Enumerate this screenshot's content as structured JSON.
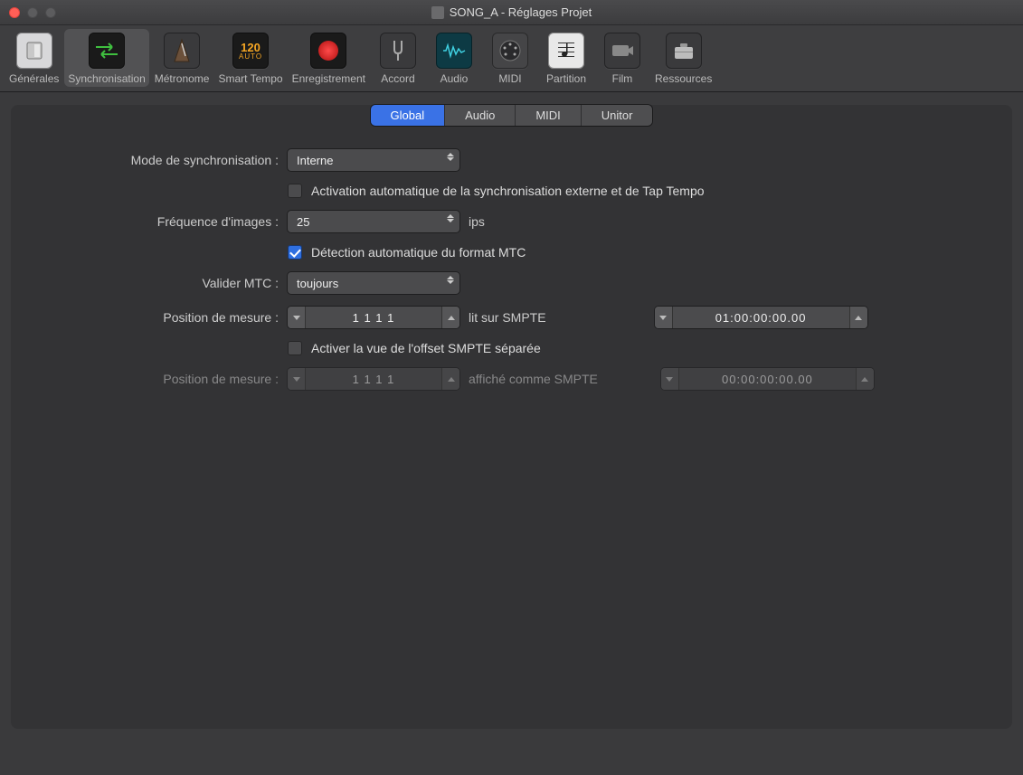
{
  "window": {
    "title": "SONG_A - Réglages Projet"
  },
  "toolbar": {
    "items": [
      {
        "label": "Générales",
        "icon": "switch-icon"
      },
      {
        "label": "Synchronisation",
        "icon": "sync-arrows-icon",
        "active": true
      },
      {
        "label": "Métronome",
        "icon": "metronome-icon"
      },
      {
        "label": "Smart Tempo",
        "icon": "smart-tempo-icon"
      },
      {
        "label": "Enregistrement",
        "icon": "record-icon"
      },
      {
        "label": "Accord",
        "icon": "tuning-fork-icon"
      },
      {
        "label": "Audio",
        "icon": "audio-wave-icon"
      },
      {
        "label": "MIDI",
        "icon": "midi-icon"
      },
      {
        "label": "Partition",
        "icon": "score-icon"
      },
      {
        "label": "Film",
        "icon": "film-icon"
      },
      {
        "label": "Ressources",
        "icon": "briefcase-icon"
      }
    ]
  },
  "tabs": {
    "items": [
      "Global",
      "Audio",
      "MIDI",
      "Unitor"
    ],
    "selected": 0
  },
  "form": {
    "sync_mode_label": "Mode de synchronisation :",
    "sync_mode_value": "Interne",
    "auto_ext_sync_label": "Activation automatique de la synchronisation externe et de Tap Tempo",
    "auto_ext_sync_checked": false,
    "frame_rate_label": "Fréquence d'images :",
    "frame_rate_value": "25",
    "frame_rate_unit": "ips",
    "auto_mtc_label": "Détection automatique du format MTC",
    "auto_mtc_checked": true,
    "validate_mtc_label": "Valider MTC :",
    "validate_mtc_value": "toujours",
    "bar_pos1_label": "Position de mesure :",
    "bar_pos1_value": "1  1  1      1",
    "reads_smpte_label": "lit sur SMPTE",
    "smpte1_value": "01:00:00:00.00",
    "sep_offset_label": "Activer la vue de l'offset SMPTE séparée",
    "sep_offset_checked": false,
    "bar_pos2_label": "Position de mesure :",
    "bar_pos2_value": "1  1  1      1",
    "displayed_smpte_label": "affiché comme SMPTE",
    "smpte2_value": "00:00:00:00.00"
  }
}
